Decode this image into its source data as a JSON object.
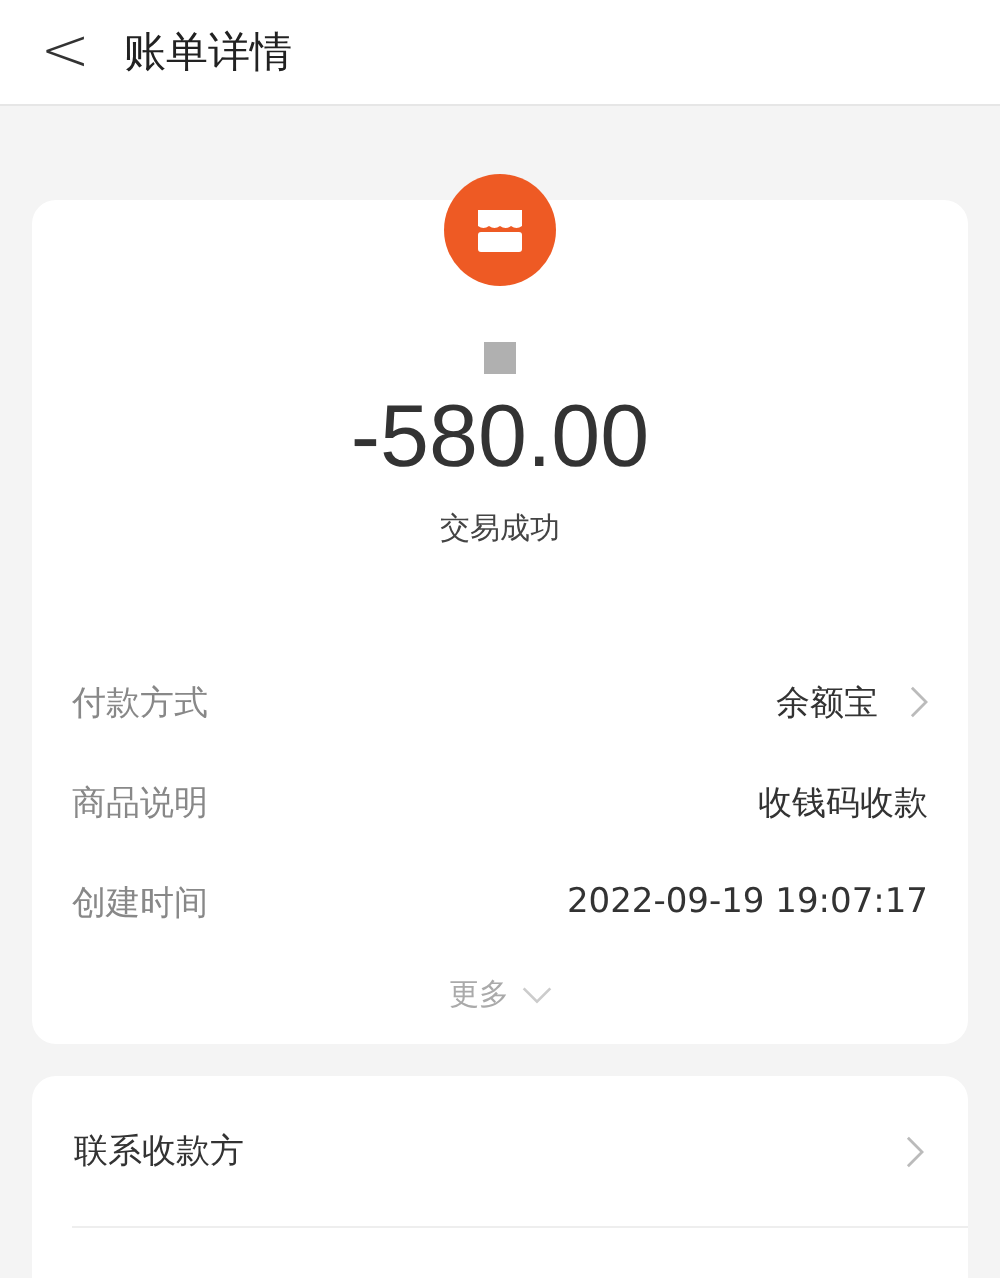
{
  "header": {
    "back": "<",
    "title": "账单详情"
  },
  "summary": {
    "amount": "-580.00",
    "status": "交易成功"
  },
  "details": [
    {
      "label": "付款方式",
      "value": "余额宝",
      "has_arrow": true
    },
    {
      "label": "商品说明",
      "value": "收钱码收款",
      "has_arrow": false
    },
    {
      "label": "创建时间",
      "value": "2022-09-19 19:07:17",
      "has_arrow": false
    }
  ],
  "more": "更多",
  "actions": [
    {
      "label": "联系收款方",
      "has_arrow": true
    }
  ]
}
